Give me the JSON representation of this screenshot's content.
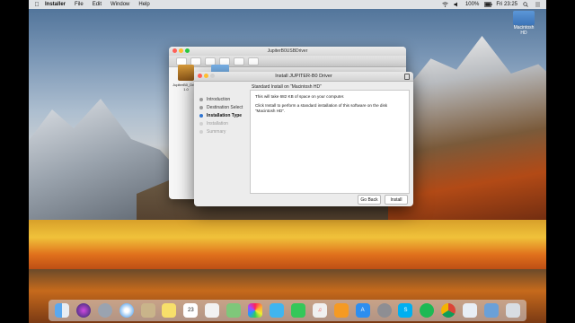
{
  "menubar": {
    "apple": "",
    "app_name": "Installer",
    "menus": [
      "File",
      "Edit",
      "Window",
      "Help"
    ],
    "battery": "100%",
    "clock": "Fri 23:25"
  },
  "desktop": {
    "drive_label": "Macintosh HD"
  },
  "finder": {
    "title": "JupiterB0USBDriver",
    "package_label": "JupiterB0_Driver 1.0"
  },
  "installer": {
    "title": "Install JUPITER-B0 Driver",
    "heading": "Standard Install on “Macintosh HD”",
    "steps": [
      "Introduction",
      "Destination Select",
      "Installation Type",
      "Installation",
      "Summary"
    ],
    "active_step": "Installation Type",
    "body_line1": "This will take 682 KB of space on your computer.",
    "body_line2": "Click Install to perform a standard installation of this software on the disk “Macintosh HD”.",
    "back_label": "Go Back",
    "install_label": "Install"
  },
  "dock": {
    "icons": [
      "finder-icon",
      "siri-icon",
      "launchpad-icon",
      "safari-icon",
      "mail-icon",
      "notes-icon",
      "calendar-icon",
      "reminders-icon",
      "maps-icon",
      "photos-icon",
      "messages-icon",
      "facetime-icon",
      "itunes-icon",
      "ibooks-icon",
      "appstore-icon",
      "preferences-icon",
      "skype-icon",
      "spotify-icon",
      "chrome-icon",
      "preview-icon",
      "downloads-icon",
      "trash-icon"
    ],
    "calendar_day": "23"
  },
  "colors": {
    "accent": "#2f74d0"
  }
}
